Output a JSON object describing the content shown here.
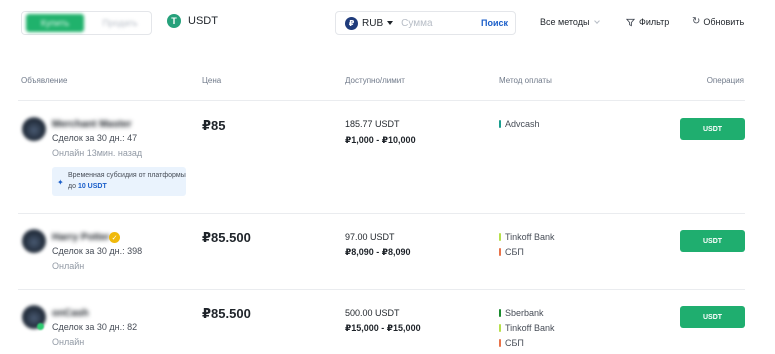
{
  "toolbar": {
    "buy_tab": "Купить",
    "sell_tab": "Продать",
    "coin": "USDT",
    "coin_icon": "tether-icon",
    "fiat": "RUB",
    "fiat_icon": "ruble-icon",
    "amount_placeholder": "Сумма",
    "search_label": "Поиск",
    "methods_label": "Все методы",
    "filter_label": "Фильтр",
    "refresh_label": "Обновить"
  },
  "table": {
    "headers": {
      "advertiser": "Объявление",
      "price": "Цена",
      "available": "Доступно/лимит",
      "payment": "Метод оплаты",
      "operation": "Операция"
    },
    "rows": [
      {
        "name": "Merchant Master",
        "verified": false,
        "deals": "Сделок за 30 дн.: 47",
        "status": "Онлайн 13мин. назад",
        "subsidy_text": "Временная субсидия от платформы до",
        "subsidy_amount": "10 USDT",
        "price": "₽85",
        "available": "185.77 USDT",
        "limit": "₽1,000 - ₽10,000",
        "methods": [
          {
            "name": "Advcash",
            "color": "#1b9e8f"
          }
        ],
        "button": "USDT"
      },
      {
        "name": "Harry Potter",
        "verified": true,
        "deals": "Сделок за 30 дн.: 398",
        "status": "Онлайн",
        "price": "₽85.500",
        "available": "97.00 USDT",
        "limit": "₽8,090 - ₽8,090",
        "methods": [
          {
            "name": "Tinkoff Bank",
            "color": "#b7e04b"
          },
          {
            "name": "СБП",
            "color": "#e8734a"
          }
        ],
        "button": "USDT"
      },
      {
        "name": "onCash",
        "verified": false,
        "deals": "Сделок за 30 дн.: 82",
        "status": "Онлайн",
        "price": "₽85.500",
        "available": "500.00 USDT",
        "limit": "₽15,000 - ₽15,000",
        "methods": [
          {
            "name": "Sberbank",
            "color": "#1a8a2e"
          },
          {
            "name": "Tinkoff Bank",
            "color": "#b7e04b"
          },
          {
            "name": "СБП",
            "color": "#e8734a"
          }
        ],
        "button": "USDT"
      }
    ]
  }
}
